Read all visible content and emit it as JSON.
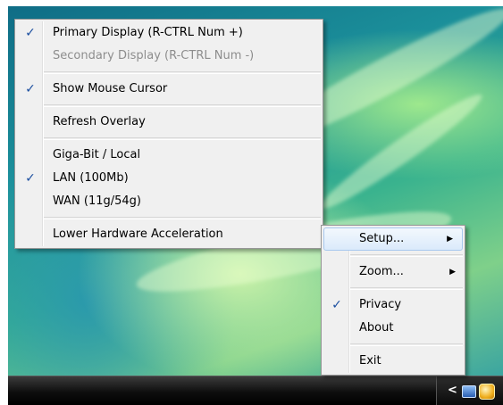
{
  "context_menu": {
    "items": [
      {
        "label": "Primary Display (R-CTRL Num +)",
        "checked": true,
        "enabled": true
      },
      {
        "label": "Secondary Display (R-CTRL Num -)",
        "checked": false,
        "enabled": false
      },
      {
        "label": "Show Mouse Cursor",
        "checked": true,
        "enabled": true
      },
      {
        "label": "Refresh Overlay",
        "checked": false,
        "enabled": true
      },
      {
        "label": "Giga-Bit / Local",
        "checked": false,
        "enabled": true
      },
      {
        "label": "LAN (100Mb)",
        "checked": true,
        "enabled": true
      },
      {
        "label": "WAN (11g/54g)",
        "checked": false,
        "enabled": true
      },
      {
        "label": "Lower Hardware Acceleration",
        "checked": false,
        "enabled": true
      }
    ],
    "check_glyph": "✓"
  },
  "tray_menu": {
    "items": [
      {
        "label": "Setup...",
        "submenu": true,
        "highlighted": true
      },
      {
        "label": "Zoom...",
        "submenu": true
      },
      {
        "label": "Privacy",
        "checked": true
      },
      {
        "label": "About"
      },
      {
        "label": "Exit"
      }
    ],
    "submenu_glyph": "▶"
  },
  "taskbar": {
    "tray_chevron": "<",
    "icons": [
      "network-icon",
      "app-tray-icon"
    ]
  },
  "colors": {
    "menu_bg": "#f0f0f0",
    "check": "#1c4fa0",
    "disabled_text": "#8d8d8d",
    "highlight": "#dbeafb"
  }
}
